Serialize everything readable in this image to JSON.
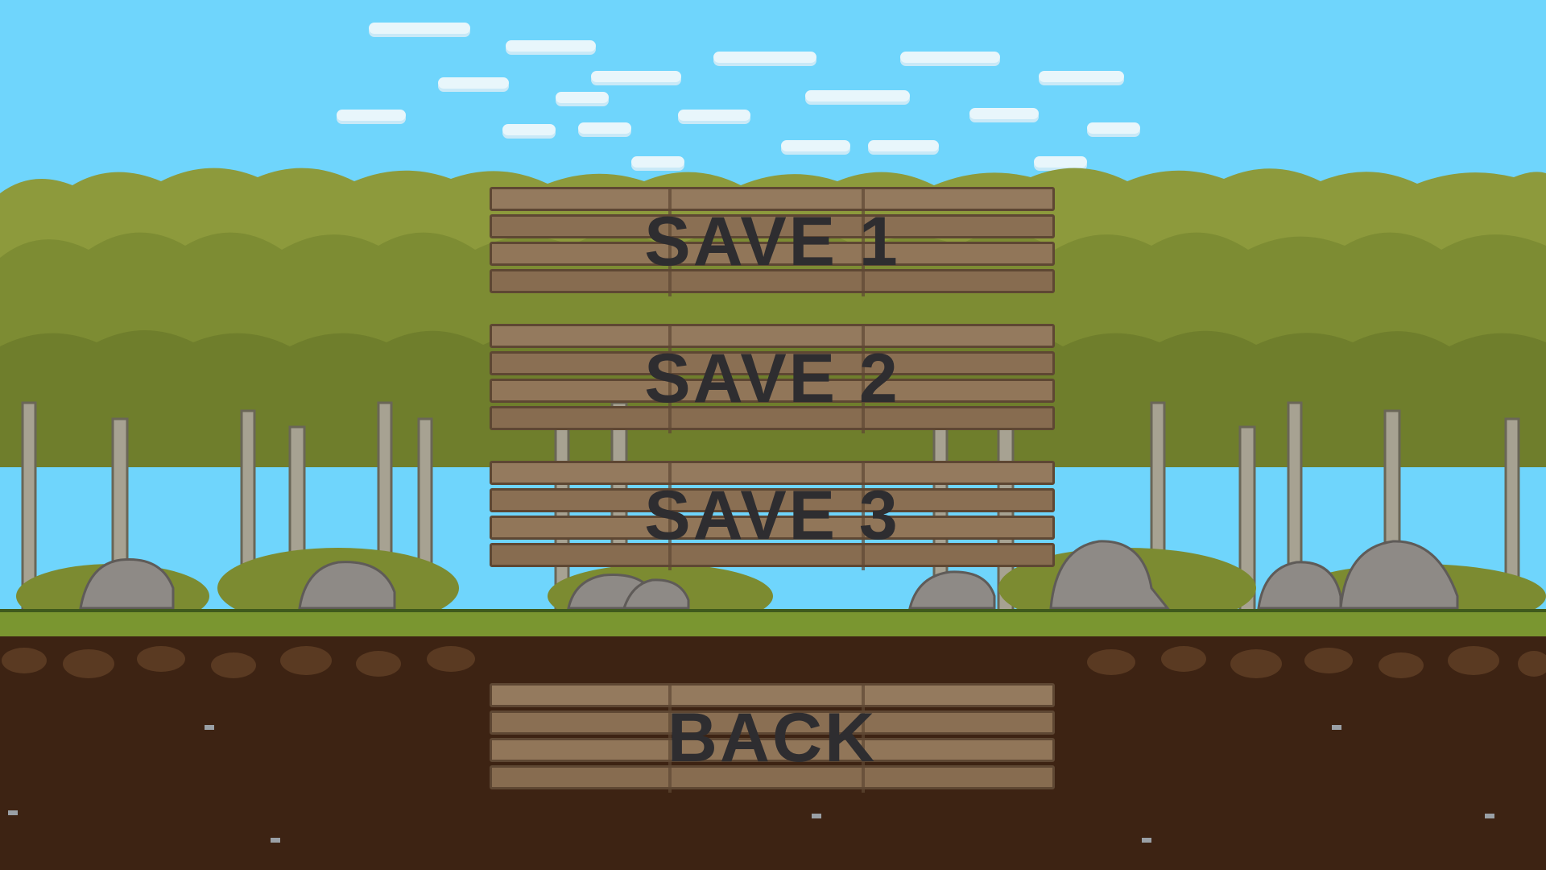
{
  "menu": {
    "save_slots": [
      {
        "label": "SAVE 1"
      },
      {
        "label": "SAVE 2"
      },
      {
        "label": "SAVE 3"
      }
    ],
    "back_label": "BACK"
  },
  "colors": {
    "sky": "#6fd5fc",
    "foliage": "#8d9a3c",
    "grass": "#7a9630",
    "soil": "#3d2313",
    "sign_wood": "#8e7256",
    "sign_text": "#2e2d30"
  }
}
